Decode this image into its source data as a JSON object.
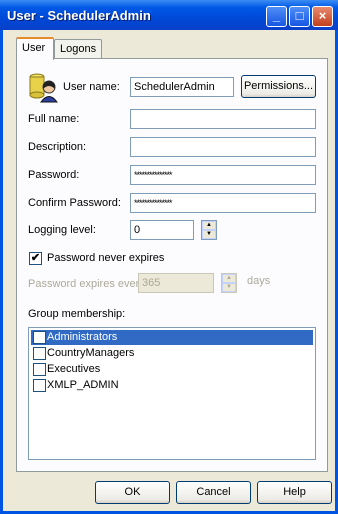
{
  "window": {
    "title": "User - SchedulerAdmin"
  },
  "tabs": [
    {
      "label": "User"
    },
    {
      "label": "Logons"
    }
  ],
  "form": {
    "user_name_label": "User name:",
    "user_name_value": "SchedulerAdmin",
    "permissions_button": "Permissions...",
    "full_name_label": "Full name:",
    "full_name_value": "",
    "description_label": "Description:",
    "description_value": "",
    "password_label": "Password:",
    "password_value": "***************",
    "confirm_password_label": "Confirm Password:",
    "confirm_password_value": "***************",
    "logging_level_label": "Logging level:",
    "logging_level_value": "0",
    "never_expires_label": "Password never expires",
    "never_expires_checked": true,
    "expires_every_label": "Password expires every",
    "expires_every_value": "365",
    "days_label": "days",
    "group_membership_label": "Group membership:"
  },
  "groups": [
    {
      "label": "Administrators",
      "checked": true,
      "selected": true
    },
    {
      "label": "CountryManagers",
      "checked": false,
      "selected": false
    },
    {
      "label": "Executives",
      "checked": false,
      "selected": false
    },
    {
      "label": "XMLP_ADMIN",
      "checked": false,
      "selected": false
    }
  ],
  "buttons": {
    "ok": "OK",
    "cancel": "Cancel",
    "help": "Help"
  },
  "title_buttons": {
    "minimize": "_",
    "maximize": "□",
    "close": "×"
  },
  "check_glyph": "✔",
  "colors": {
    "title_bar": "#0054e3",
    "selection": "#316ac5",
    "face": "#ece9d8"
  }
}
